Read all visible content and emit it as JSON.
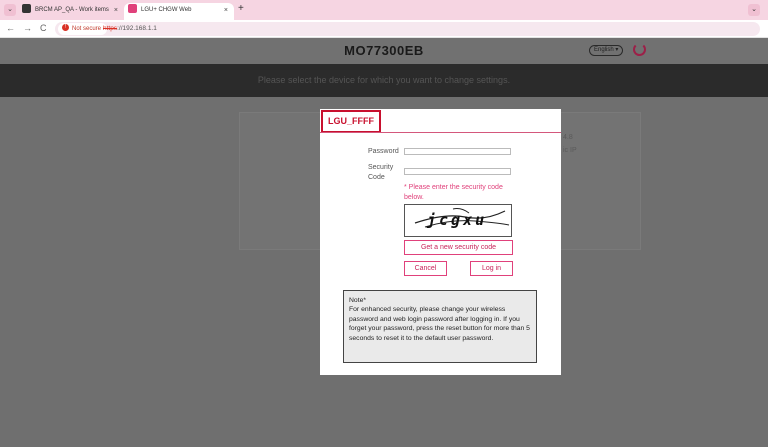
{
  "browser": {
    "tabs": [
      {
        "label": "BRCM AP_QA - Work items",
        "active": false
      },
      {
        "label": "LGU+ CHGW Web",
        "active": true
      }
    ],
    "new_tab": "+",
    "tab_close": "×",
    "not_secure": "Not secure",
    "url_scheme": "https",
    "url_rest": "://192.168.1.1",
    "nav": {
      "back": "←",
      "forward": "→",
      "reload": "C"
    }
  },
  "header": {
    "model": "MO77300EB",
    "language": "English"
  },
  "banner": {
    "text": "Please select the device for which you want to change settings."
  },
  "background_fragments": {
    "line1": "4.8",
    "line2": "ic IP"
  },
  "modal": {
    "title": "LGU_FFFF",
    "password_label": "Password",
    "security_code_label_line1": "Security",
    "security_code_label_line2": "Code",
    "hint": "* Please enter the security code below.",
    "captcha_text": "jcgxu",
    "new_code_button": "Get a new security code",
    "cancel_button": "Cancel",
    "login_button": "Log in",
    "note_title": "Note*",
    "note_body": "For enhanced security, please change your wireless password and web login password after logging in. If you forget your password, press the reset button for more than 5 seconds to reset it to the default user password."
  },
  "colors": {
    "accent": "#e0417b",
    "title_red": "#c8102e"
  }
}
